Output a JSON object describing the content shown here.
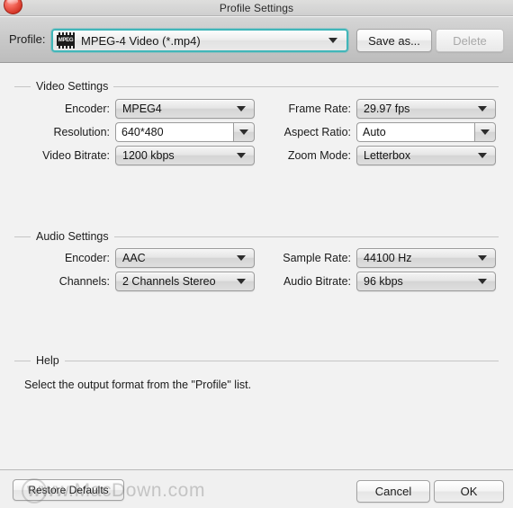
{
  "window": {
    "title": "Profile Settings",
    "close_icon": "close-icon"
  },
  "profile_bar": {
    "label": "Profile:",
    "icon": "mpeg-video-file-icon",
    "icon_text": "MPEG",
    "value": "MPEG-4 Video (*.mp4)",
    "save_as_label": "Save as...",
    "delete_label": "Delete",
    "accent_focus_color": "#41b6b9"
  },
  "video_settings": {
    "title": "Video Settings",
    "fields": [
      {
        "label": "Encoder:",
        "value": "MPEG4",
        "style": "popup"
      },
      {
        "label": "Resolution:",
        "value": "640*480",
        "style": "combo"
      },
      {
        "label": "Video Bitrate:",
        "value": "1200 kbps",
        "style": "popup"
      },
      {
        "label": "Frame Rate:",
        "value": "29.97 fps",
        "style": "popup"
      },
      {
        "label": "Aspect Ratio:",
        "value": "Auto",
        "style": "combo"
      },
      {
        "label": "Zoom Mode:",
        "value": "Letterbox",
        "style": "popup"
      }
    ]
  },
  "audio_settings": {
    "title": "Audio Settings",
    "fields": [
      {
        "label": "Encoder:",
        "value": "AAC",
        "style": "popup"
      },
      {
        "label": "Channels:",
        "value": "2 Channels Stereo",
        "style": "popup"
      },
      {
        "label": "Sample Rate:",
        "value": "44100 Hz",
        "style": "popup"
      },
      {
        "label": "Audio Bitrate:",
        "value": "96 kbps",
        "style": "popup"
      }
    ]
  },
  "help": {
    "title": "Help",
    "text": "Select the output format from the \"Profile\" list."
  },
  "footer": {
    "restore_label": "Restore Defaults",
    "cancel_label": "Cancel",
    "ok_label": "OK"
  },
  "watermark": {
    "text": "www.MacDown.com"
  }
}
